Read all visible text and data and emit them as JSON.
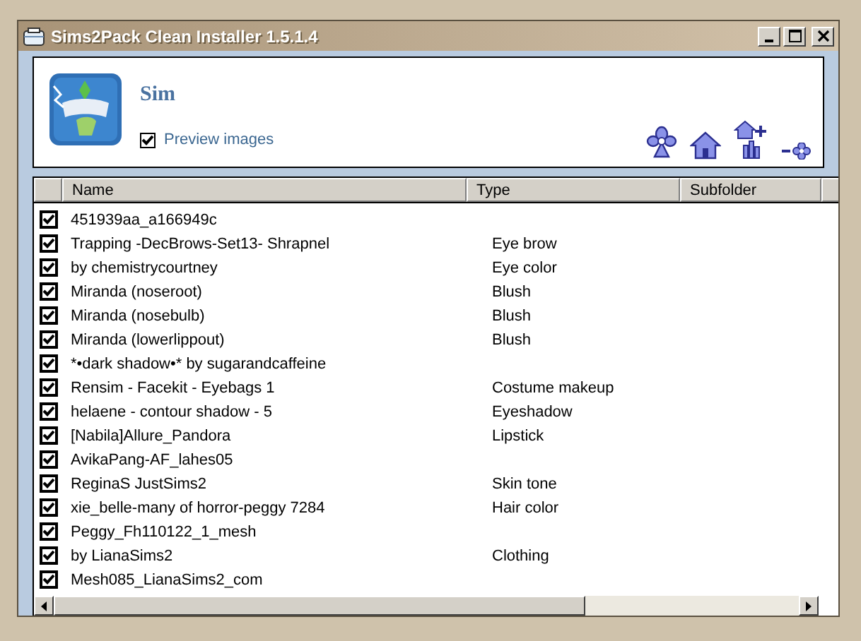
{
  "window": {
    "title": "Sims2Pack Clean Installer 1.5.1.4"
  },
  "header": {
    "title": "Sim",
    "preview": {
      "label": "Preview images",
      "checked": true
    }
  },
  "table": {
    "columns": [
      "Name",
      "Type",
      "Subfolder"
    ],
    "rows": [
      {
        "checked": true,
        "name": "451939aa_a166949c"
      },
      {
        "checked": true,
        "name": "Trapping -DecBrows-Set13- Shrapnel",
        "type": "Eye brow"
      },
      {
        "checked": true,
        "name": "by chemistrycourtney",
        "type": "Eye color"
      },
      {
        "checked": true,
        "name": "Miranda (noseroot)",
        "type": "Blush"
      },
      {
        "checked": true,
        "name": "Miranda (nosebulb)",
        "type": "Blush"
      },
      {
        "checked": true,
        "name": "Miranda (lowerlippout)",
        "type": "Blush"
      },
      {
        "checked": true,
        "name": "*•dark shadow•* by sugarandcaffeine"
      },
      {
        "checked": true,
        "name": "Rensim - Facekit - Eyebags 1",
        "type": "Costume makeup"
      },
      {
        "checked": true,
        "name": "helaene - contour shadow - 5",
        "type": "Eyeshadow"
      },
      {
        "checked": true,
        "name": "[Nabila]Allure_Pandora",
        "type": "Lipstick"
      },
      {
        "checked": true,
        "name": "AvikaPang-AF_lahes05"
      },
      {
        "checked": true,
        "name": "ReginaS JustSims2",
        "type": "Skin tone"
      },
      {
        "checked": true,
        "name": "xie_belle-many of horror-peggy 7284",
        "type": "Hair color"
      },
      {
        "checked": true,
        "name": "Peggy_Fh110122_1_mesh"
      },
      {
        "checked": true,
        "name": "by LianaSims2",
        "type": "Clothing"
      },
      {
        "checked": true,
        "name": "Mesh085_LianaSims2_com"
      }
    ]
  }
}
